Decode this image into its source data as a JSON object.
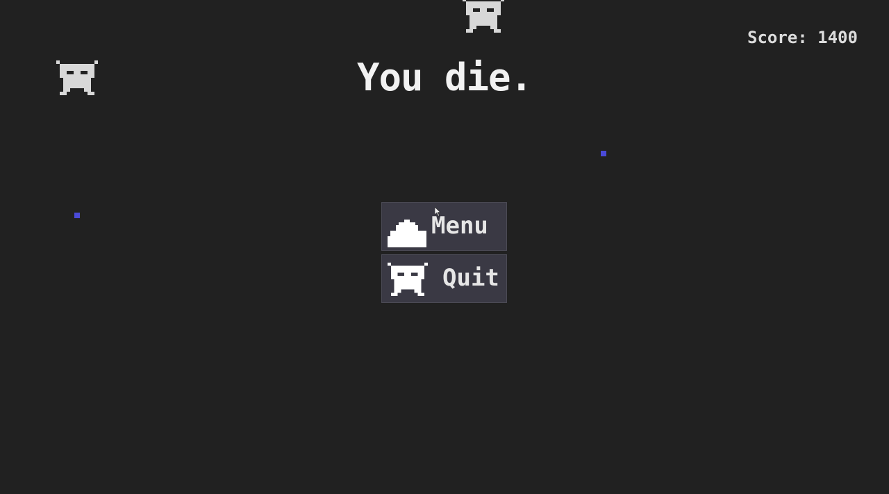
{
  "hud": {
    "score_text": "Score: 1400"
  },
  "status": {
    "message": "You die."
  },
  "buttons": {
    "menu_label": "Menu",
    "quit_label": "Quit"
  },
  "icons": {
    "menu_icon": "bell-dome-icon",
    "quit_icon": "alien-icon",
    "enemy": "alien-icon",
    "star": "star-particle"
  },
  "colors": {
    "background": "#212121",
    "button": "#3a3944",
    "text": "#f2f2f2",
    "alien": "#d8d8d8",
    "star": "#4a4ad8"
  }
}
